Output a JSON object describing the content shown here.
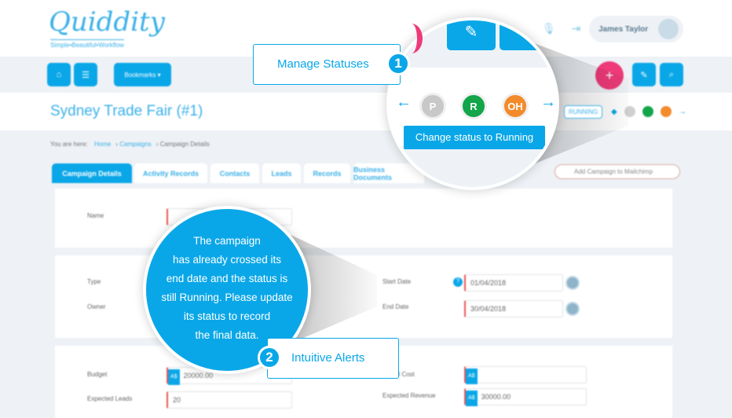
{
  "brand": {
    "logo": "Quiddity",
    "tagline": "Simple•Beautiful•Workflow"
  },
  "header": {
    "user_name": "James Taylor"
  },
  "navbar": {
    "bookmarks_label": "Bookmarks ▾"
  },
  "page": {
    "title": "Sydney Trade Fair (#1)",
    "status_badge": "RUNNING"
  },
  "breadcrumb": {
    "prefix": "You are here:",
    "items": [
      "Home",
      "Campaigns",
      "Campaign Details"
    ]
  },
  "tabs": [
    "Campaign Details",
    "Activity Records",
    "Contacts",
    "Leads",
    "Records",
    "Business Documents"
  ],
  "mailchimp_button": "Add Campaign to Mailchimp",
  "form": {
    "name_label": "Name",
    "type_label": "Type",
    "owner_label": "Owner",
    "start_date_label": "Start Date",
    "start_date": "01/04/2018",
    "end_date_label": "End Date",
    "end_date": "30/04/2018",
    "budget_label": "Budget",
    "budget": "20000.00",
    "expected_leads_label": "Expected Leads",
    "expected_leads": "20",
    "actual_cost_label": "Actual Cost",
    "expected_revenue_label": "Expected Revenue",
    "expected_revenue": "30000.00",
    "currency": "A$"
  },
  "magnifier": {
    "statuses": [
      {
        "code": "P",
        "color": "#c8c8c8"
      },
      {
        "code": "R",
        "color": "#12a54a"
      },
      {
        "code": "OH",
        "color": "#f38a2c"
      }
    ],
    "tooltip": "Change status to Running"
  },
  "callouts": [
    {
      "number": "1",
      "label": "Manage Statuses"
    },
    {
      "number": "2",
      "label": "Intuitive Alerts"
    }
  ],
  "alert": {
    "lines": [
      "The campaign",
      "has already crossed its",
      "end date and the status is",
      "still Running. Please update",
      "its status to record",
      "the final data."
    ]
  },
  "colors": {
    "accent": "#0aa7e8",
    "pink": "#ee3a78"
  }
}
